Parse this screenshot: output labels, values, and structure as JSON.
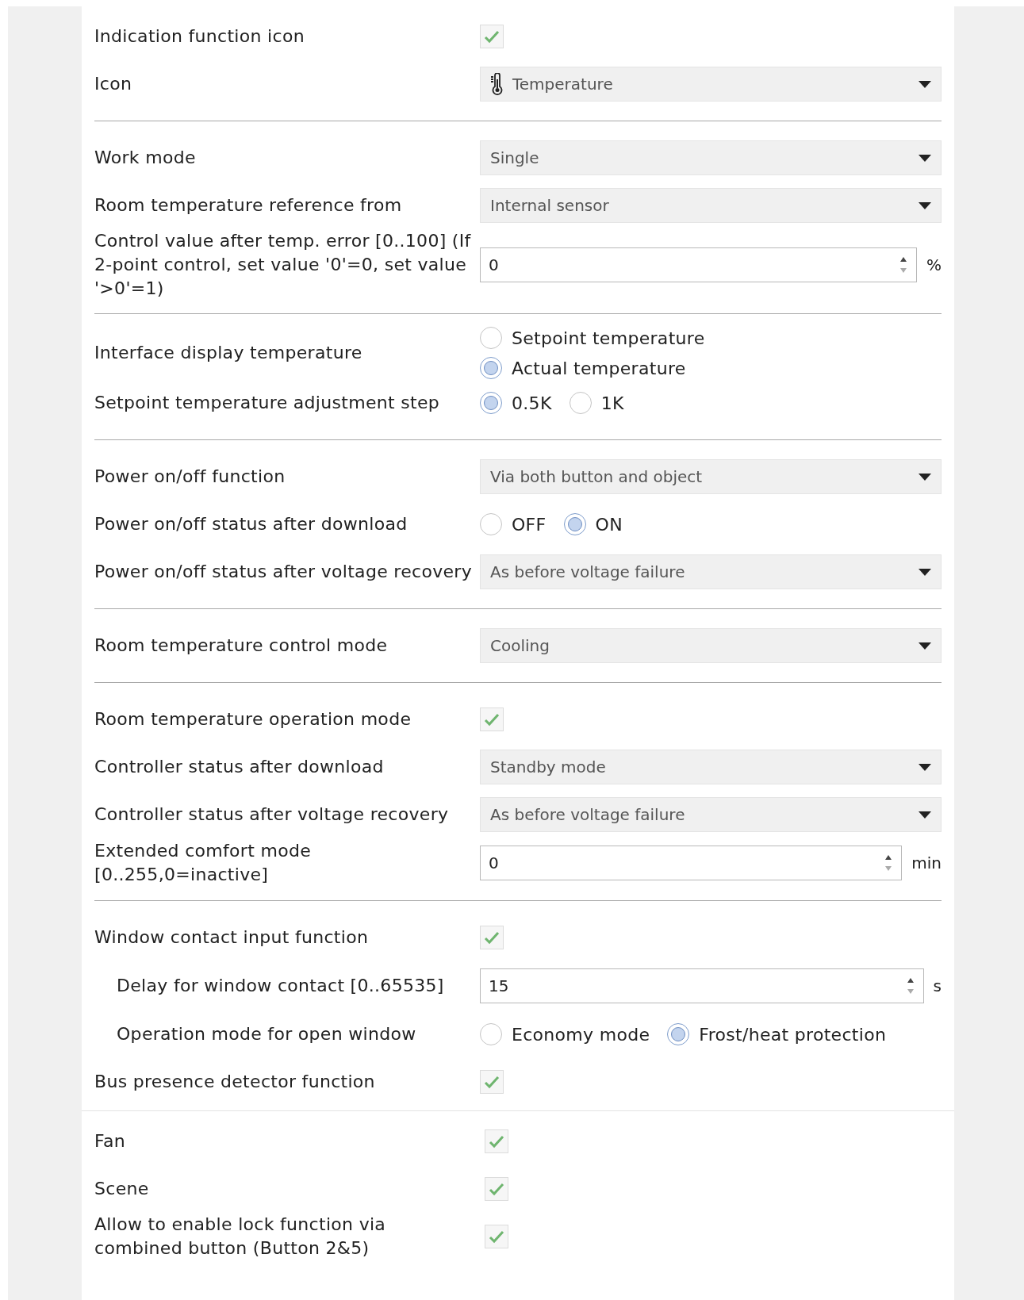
{
  "sections": [
    {
      "rows": [
        {
          "kind": "checkbox",
          "label": "Indication function icon",
          "checked": true
        },
        {
          "kind": "icon-dropdown",
          "label": "Icon",
          "value": "Temperature"
        }
      ]
    },
    {
      "rows": [
        {
          "kind": "dropdown",
          "label": "Work mode",
          "value": "Single"
        },
        {
          "kind": "dropdown",
          "label": "Room temperature reference from",
          "value": "Internal sensor"
        },
        {
          "kind": "spin",
          "label": "Control value after temp. error [0..100] (If 2-point control, set value '0'=0, set value '>0'=1)",
          "value": "0",
          "unit": "%"
        }
      ]
    },
    {
      "rows": [
        {
          "kind": "radio-column",
          "label": "Interface display temperature",
          "options": [
            {
              "label": "Setpoint temperature",
              "selected": false
            },
            {
              "label": "Actual temperature",
              "selected": true
            }
          ]
        },
        {
          "kind": "radio",
          "label": "Setpoint temperature adjustment step",
          "options": [
            {
              "label": "0.5K",
              "selected": true
            },
            {
              "label": "1K",
              "selected": false
            }
          ]
        }
      ]
    },
    {
      "rows": [
        {
          "kind": "dropdown",
          "label": "Power on/off function",
          "value": "Via both button and object"
        },
        {
          "kind": "radio",
          "label": "Power on/off status after download",
          "options": [
            {
              "label": "OFF",
              "selected": false
            },
            {
              "label": "ON",
              "selected": true
            }
          ]
        },
        {
          "kind": "dropdown",
          "label": "Power on/off status after voltage recovery",
          "value": "As before voltage failure"
        }
      ]
    },
    {
      "rows": [
        {
          "kind": "dropdown",
          "label": "Room temperature control mode",
          "value": "Cooling"
        }
      ]
    },
    {
      "rows": [
        {
          "kind": "checkbox",
          "label": "Room temperature operation mode",
          "checked": true
        },
        {
          "kind": "dropdown",
          "label": "Controller status after download",
          "value": "Standby mode"
        },
        {
          "kind": "dropdown",
          "label": "Controller status after voltage recovery",
          "value": "As before voltage failure"
        },
        {
          "kind": "spin",
          "label": "Extended comfort mode [0..255,0=inactive]",
          "value": "0",
          "unit": "min"
        }
      ]
    },
    {
      "rows": [
        {
          "kind": "checkbox",
          "label": "Window contact input function",
          "checked": true,
          "children": [
            {
              "kind": "spin",
              "label": "Delay for window contact [0..65535]",
              "value": "15",
              "unit": "s"
            },
            {
              "kind": "radio",
              "label": "Operation mode for open window",
              "options": [
                {
                  "label": "Economy mode",
                  "selected": false
                },
                {
                  "label": "Frost/heat protection",
                  "selected": true
                }
              ]
            }
          ]
        },
        {
          "kind": "checkbox",
          "label": "Bus presence detector function",
          "checked": true
        }
      ]
    }
  ],
  "extra_rows": [
    {
      "kind": "checkbox",
      "label": "Fan",
      "checked": true
    },
    {
      "kind": "checkbox",
      "label": "Scene",
      "checked": true
    },
    {
      "kind": "checkbox",
      "label": "Allow to enable lock function via combined button (Button 2&5)",
      "checked": true
    }
  ]
}
